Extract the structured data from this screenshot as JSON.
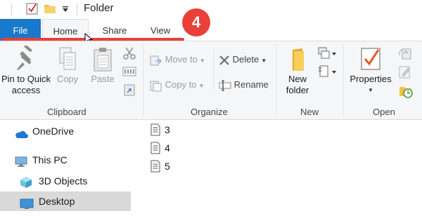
{
  "window": {
    "title": "Folder",
    "quick_access_icons": [
      "checkbox-properties-icon",
      "folder-icon",
      "dropdown-arrow-icon"
    ]
  },
  "tabs": [
    {
      "label": "File"
    },
    {
      "label": "Home"
    },
    {
      "label": "Share"
    },
    {
      "label": "View"
    }
  ],
  "annotation": {
    "step": "4",
    "color": "#e8403a"
  },
  "ribbon": {
    "clipboard": {
      "label": "Clipboard",
      "pin": "Pin to Quick access",
      "pin_line1": "Pin to Quick",
      "pin_line2": "access",
      "copy": "Copy",
      "paste": "Paste"
    },
    "organize": {
      "label": "Organize",
      "move_to": "Move to",
      "copy_to": "Copy to",
      "delete": "Delete",
      "rename": "Rename"
    },
    "new": {
      "label": "New",
      "new_folder_line1": "New",
      "new_folder_line2": "folder"
    },
    "open": {
      "label": "Open",
      "properties": "Properties"
    }
  },
  "nav": {
    "items": [
      {
        "label": "OneDrive",
        "icon": "onedrive-cloud-icon"
      },
      {
        "label": "This PC",
        "icon": "this-pc-icon"
      },
      {
        "label": "3D Objects",
        "icon": "3d-objects-icon"
      },
      {
        "label": "Desktop",
        "icon": "desktop-icon",
        "selected": true
      }
    ]
  },
  "files": [
    {
      "name": "3"
    },
    {
      "name": "4"
    },
    {
      "name": "5"
    }
  ],
  "colors": {
    "file_tab": "#1979ca",
    "ribbon_bg": "#f5f6f7",
    "accent_red": "#e8403a",
    "folder_yellow": "#f3c04c",
    "selected_nav": "#d9d9d9"
  }
}
